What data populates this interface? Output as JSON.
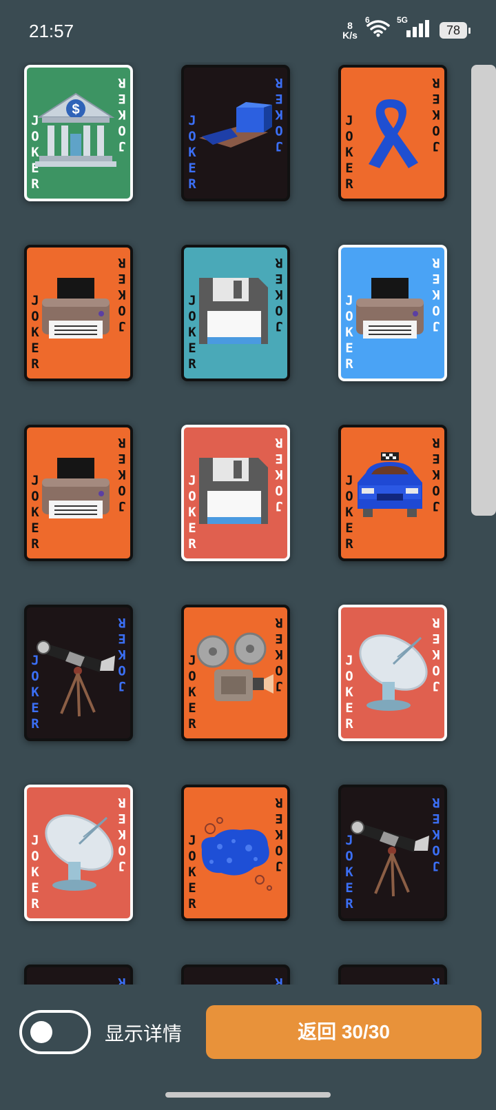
{
  "status_bar": {
    "time": "21:57",
    "net_speed_value": "8",
    "net_speed_unit": "K/s",
    "wifi_label": "6",
    "signal_label": "5G",
    "battery": "78"
  },
  "joker_text": "JOKER",
  "cards": [
    {
      "id": "bank",
      "bg": "#3d9463",
      "border": "white",
      "joker_color": "#ffffff",
      "icon": "bank-icon"
    },
    {
      "id": "pencil-case",
      "bg": "#1c1416",
      "border": "dark",
      "joker_color": "#3b6ff5",
      "icon": "pencil-case-icon"
    },
    {
      "id": "ribbon",
      "bg": "#ee6a2c",
      "border": "dark",
      "joker_color": "#111111",
      "icon": "ribbon-icon"
    },
    {
      "id": "printer-brown",
      "bg": "#ee6a2c",
      "border": "dark",
      "joker_color": "#111111",
      "icon": "printer-icon"
    },
    {
      "id": "floppy-teal",
      "bg": "#4aa9b8",
      "border": "dark",
      "joker_color": "#111111",
      "icon": "floppy-disk-icon"
    },
    {
      "id": "printer-gray",
      "bg": "#4aa3f5",
      "border": "white",
      "joker_color": "#ffffff",
      "icon": "printer-icon"
    },
    {
      "id": "printer-brown-2",
      "bg": "#ee6a2c",
      "border": "dark",
      "joker_color": "#111111",
      "icon": "printer-icon"
    },
    {
      "id": "floppy-red",
      "bg": "#e0604f",
      "border": "white",
      "joker_color": "#ffffff",
      "icon": "floppy-disk-icon"
    },
    {
      "id": "taxi",
      "bg": "#ee6a2c",
      "border": "dark",
      "joker_color": "#111111",
      "icon": "taxi-icon"
    },
    {
      "id": "telescope",
      "bg": "#1c1416",
      "border": "dark",
      "joker_color": "#3b6ff5",
      "icon": "telescope-icon"
    },
    {
      "id": "film-projector",
      "bg": "#ee6a2c",
      "border": "dark",
      "joker_color": "#111111",
      "icon": "film-projector-icon"
    },
    {
      "id": "satellite-dish",
      "bg": "#e0604f",
      "border": "white",
      "joker_color": "#ffffff",
      "icon": "satellite-dish-icon"
    },
    {
      "id": "satellite-dish-2",
      "bg": "#e0604f",
      "border": "white",
      "joker_color": "#ffffff",
      "icon": "satellite-dish-icon"
    },
    {
      "id": "sponge",
      "bg": "#ee6a2c",
      "border": "dark",
      "joker_color": "#111111",
      "icon": "sponge-icon"
    },
    {
      "id": "telescope-2",
      "bg": "#1c1416",
      "border": "dark",
      "joker_color": "#3b6ff5",
      "icon": "telescope-icon"
    },
    {
      "id": "partial-1",
      "bg": "#1c1416",
      "border": "dark",
      "joker_color": "#3b6ff5",
      "icon": ""
    },
    {
      "id": "partial-2",
      "bg": "#1c1416",
      "border": "dark",
      "joker_color": "#3b6ff5",
      "icon": ""
    },
    {
      "id": "partial-3",
      "bg": "#1c1416",
      "border": "dark",
      "joker_color": "#3b6ff5",
      "icon": ""
    }
  ],
  "bottom": {
    "toggle_label": "显示详情",
    "toggle_on": false,
    "back_button": "返回 30/30"
  },
  "colors": {
    "background": "#3a4b52",
    "accent": "#e8923a"
  }
}
